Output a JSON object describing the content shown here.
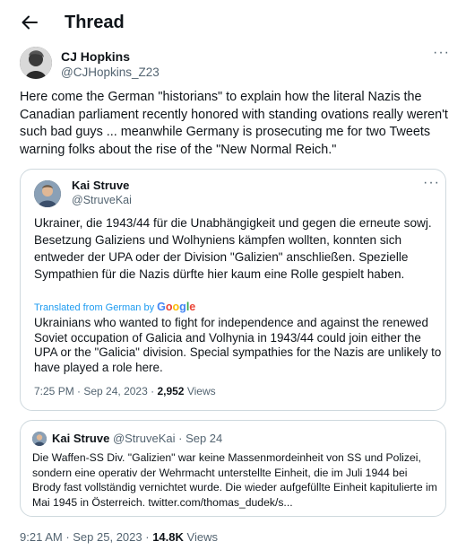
{
  "header": {
    "title": "Thread",
    "back_icon": "arrow-left-icon"
  },
  "tweet": {
    "author_name": "CJ Hopkins",
    "author_handle": "@CJHopkins_Z23",
    "text": "Here come the German \"historians\" to explain how the literal Nazis the Canadian parliament recently honored with standing ovations really weren't such bad guys ... meanwhile Germany is prosecuting me for two Tweets warning folks about the rise of the \"New Normal Reich.\"",
    "time": "9:21 AM",
    "date": "Sep 25, 2023",
    "views_count": "14.8K",
    "views_label": "Views",
    "more_label": "···"
  },
  "embedded": {
    "author_name": "Kai Struve",
    "author_handle": "@StruveKai",
    "german_text": "Ukrainer, die 1943/44 für die Unabhängigkeit und gegen die erneute sowj. Besetzung Galiziens und Wolhyniens kämpfen wollten, konnten sich entweder der UPA oder der Division \"Galizien\" anschließen. Spezielle Sympathien für die Nazis dürfte hier kaum eine Rolle gespielt haben.",
    "translated_label": "Translated from German by",
    "google_label": "Google",
    "english_text": "Ukrainians who wanted to fight for independence and against the renewed Soviet occupation of Galicia and Volhynia in 1943/44 could join either the UPA or the \"Galicia\" division. Special sympathies for the Nazis are unlikely to have played a role here.",
    "time": "7:25 PM",
    "date": "Sep 24, 2023",
    "views_count": "2,952",
    "views_label": "Views",
    "more_label": "···"
  },
  "quoted": {
    "author_name": "Kai Struve",
    "author_handle": "@StruveKai",
    "date": "Sep 24",
    "text": "Die Waffen-SS Div. \"Galizien\" war keine Massenmordeinheit von SS und Polizei, sondern eine operativ der Wehrmacht unterstellte Einheit, die im Juli 1944 bei Brody fast vollständig vernichtet wurde. Die wieder aufgefüllte Einheit kapitulierte im Mai 1945 in Österreich. twitter.com/thomas_dudek/s..."
  },
  "colors": {
    "link": "#1d9bf0",
    "secondary": "#536471",
    "border": "#cfd9de"
  }
}
